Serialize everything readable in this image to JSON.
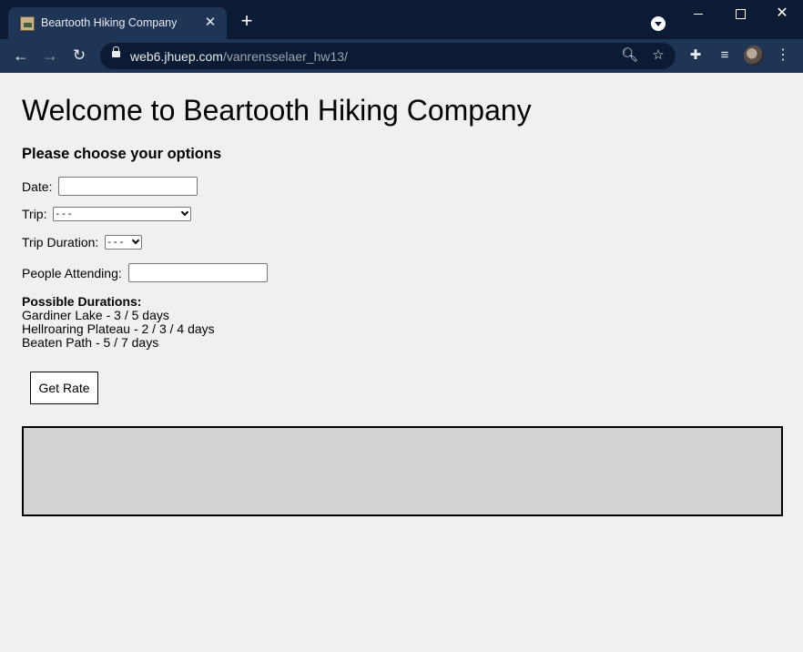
{
  "browser": {
    "tab_title": "Beartooth Hiking Company",
    "tab_close_glyph": "✕",
    "new_tab_glyph": "+",
    "url_host": "web6.jhuep.com",
    "url_path": "/vanrensselaer_hw13/",
    "icons": [
      "favicon",
      "close-icon",
      "plus-icon",
      "profile-dropdown-icon",
      "back-arrow-icon",
      "forward-arrow-icon",
      "reload-icon",
      "lock-icon",
      "zoom-icon",
      "star-icon",
      "extensions-icon",
      "media-queue-icon",
      "avatar",
      "more-menu-icon"
    ],
    "colors": {
      "titlebar": "#0b1b33",
      "tab": "#1f3556",
      "toolbar": "#1f3556"
    }
  },
  "page": {
    "title": "Welcome to Beartooth Hiking Company",
    "heading": "Please choose your options",
    "date_label": "Date:",
    "date_value": "",
    "trip_label": "Trip:",
    "trip_selected": "- - -",
    "duration_label": "Trip Duration:",
    "duration_selected": "- - -",
    "people_label": "People Attending:",
    "people_value": "",
    "durations_heading": "Possible Durations:",
    "durations": [
      "Gardiner Lake - 3 / 5 days",
      "Hellroaring Plateau - 2 / 3 / 4 days",
      "Beaten Path - 5 / 7 days"
    ],
    "button_label": "Get Rate",
    "result_text": "",
    "colors": {
      "background": "#f0f0f0",
      "result_box": "#d3d3d3"
    }
  }
}
